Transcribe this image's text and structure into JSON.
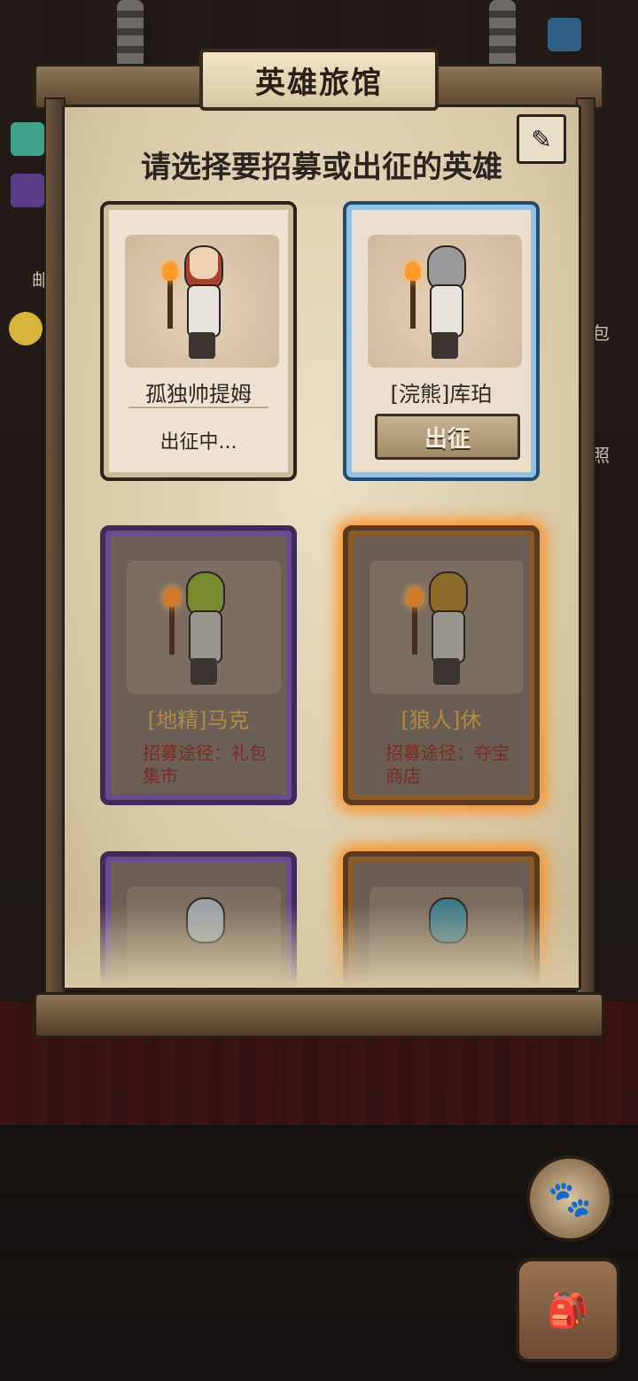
{
  "header": {
    "title": "英雄旅馆"
  },
  "panel": {
    "subtitle": "请选择要招募或出征的英雄"
  },
  "side_labels": [
    "邮",
    "包",
    "照"
  ],
  "heroes": [
    {
      "name": "孤独帅提姆",
      "status": "出征中..."
    },
    {
      "name": "[浣熊]库珀",
      "action": "出征"
    },
    {
      "name": "[地精]马克",
      "route": "招募途径：礼包集市"
    },
    {
      "name": "[狼人]休",
      "route": "招募途径：夺宝商店"
    },
    {
      "name": "",
      "route": ""
    },
    {
      "name": "",
      "route": ""
    }
  ],
  "colors": {
    "purple_frame": "#6b4b8e",
    "orange_frame": "#ff8c1a",
    "blue_frame": "#8fc2e5"
  },
  "icons": {
    "edit": "brush-icon",
    "paw": "paw-icon",
    "bag": "backpack-icon"
  }
}
